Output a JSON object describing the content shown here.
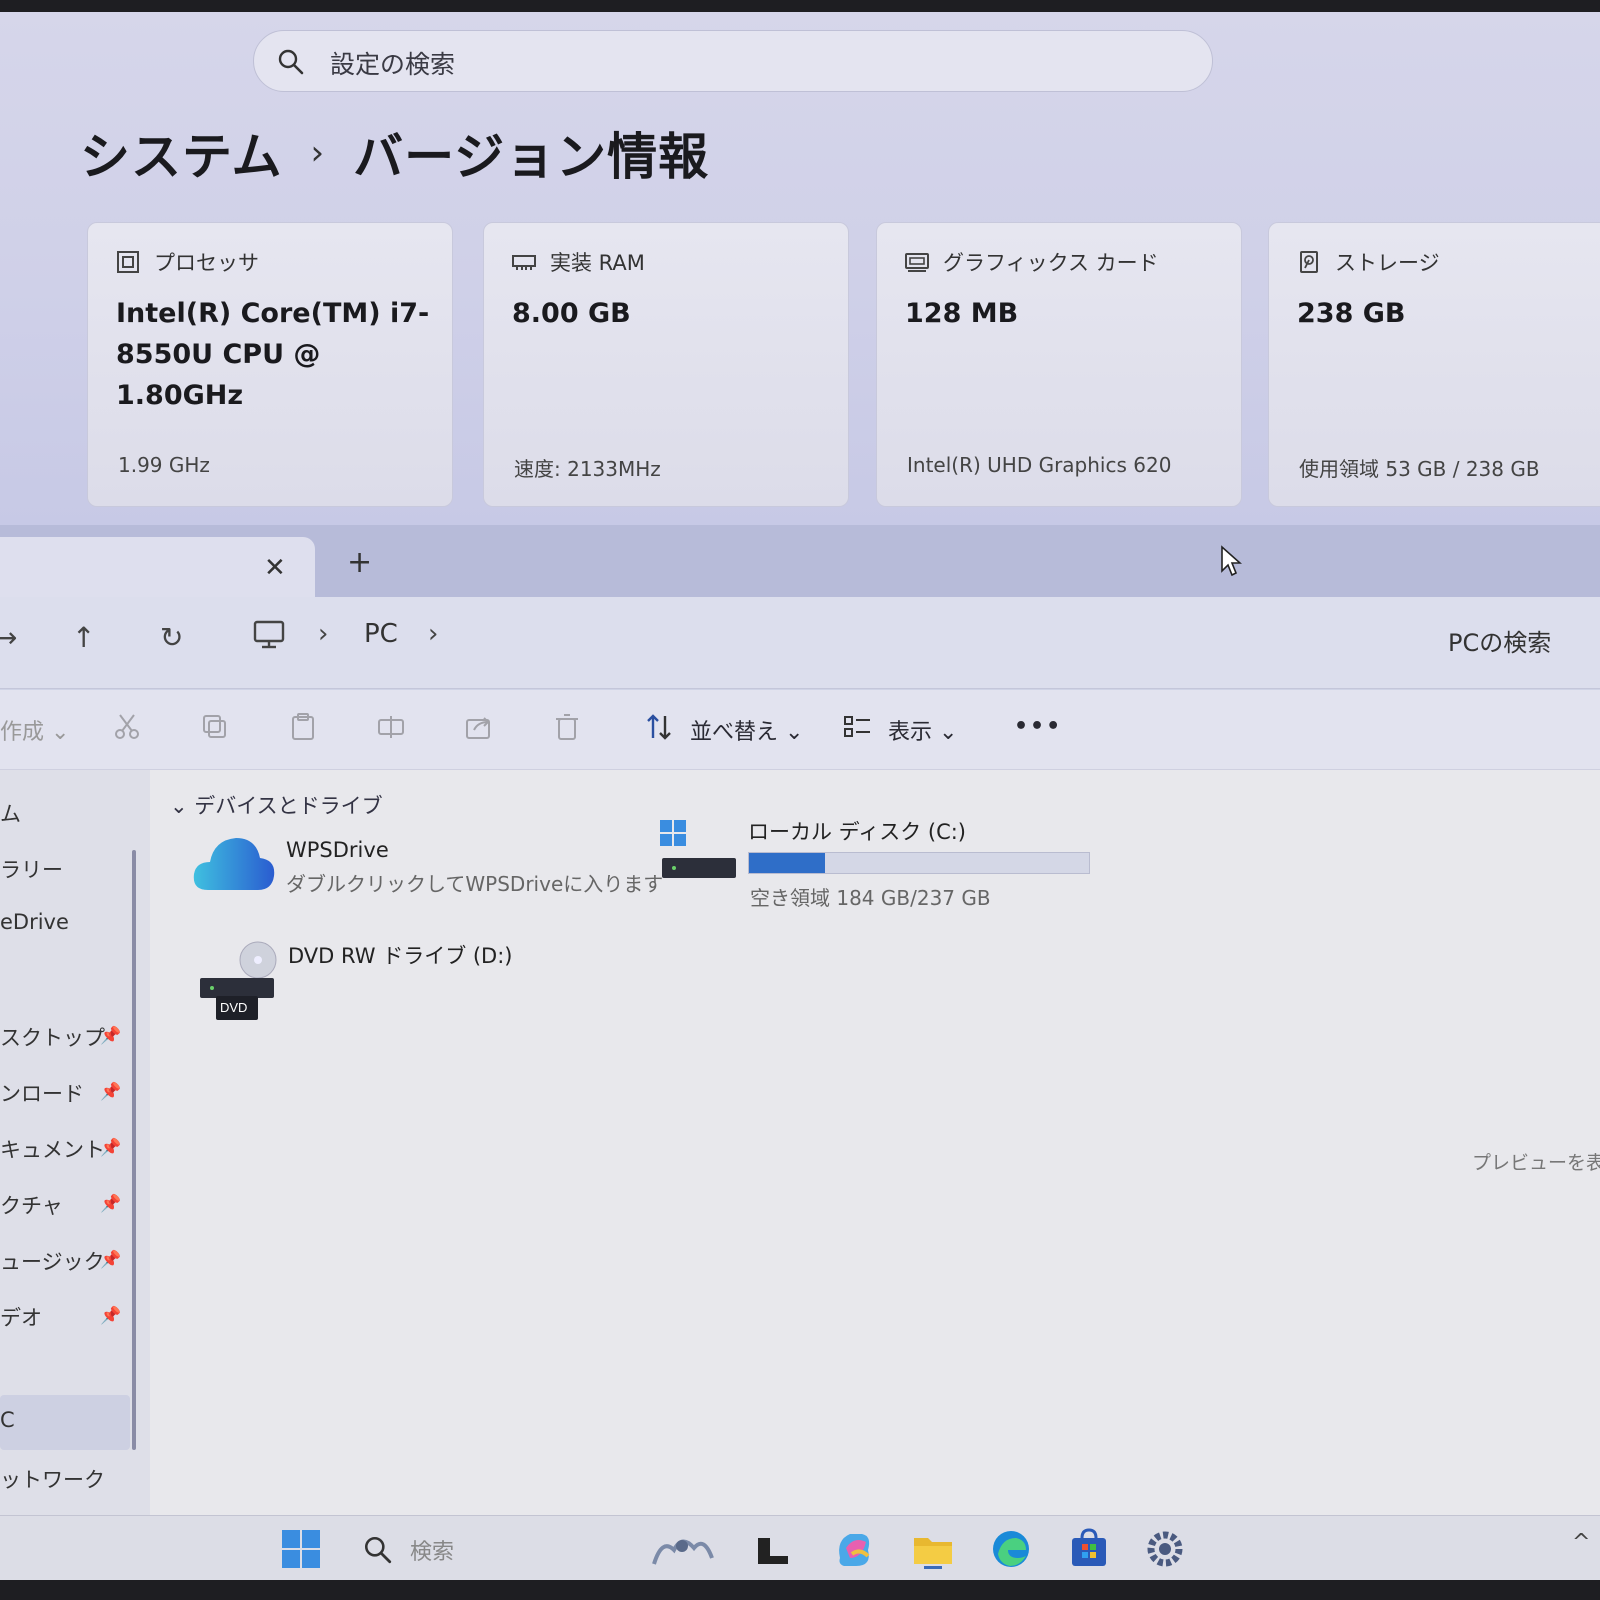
{
  "settings": {
    "search_placeholder": "設定の検索",
    "breadcrumb": {
      "parent": "システム",
      "separator": "›",
      "current": "バージョン情報"
    },
    "cards": [
      {
        "icon": "processor-icon",
        "title": "プロセッサ",
        "value": "Intel(R) Core(TM) i7-8550U CPU @ 1.80GHz",
        "sub": "1.99 GHz"
      },
      {
        "icon": "ram-icon",
        "title": "実装 RAM",
        "value": "8.00 GB",
        "sub": "速度: 2133MHz"
      },
      {
        "icon": "graphics-card-icon",
        "title": "グラフィックス カード",
        "value": "128 MB",
        "sub": "Intel(R) UHD Graphics 620"
      },
      {
        "icon": "storage-icon",
        "title": "ストレージ",
        "value": "238 GB",
        "sub": "使用領域 53 GB / 238 GB"
      }
    ]
  },
  "explorer": {
    "tab": {
      "close": "✕",
      "add": "+"
    },
    "nav": {
      "back": "→",
      "up": "↑",
      "refresh": "↻",
      "address_sep": "›",
      "address_pc": "PC",
      "search_placeholder": "PCの検索"
    },
    "cmdbar": {
      "new_label": "作成",
      "sort_label": "並べ替え",
      "view_label": "表示",
      "more_label": "•••",
      "chevron": "⌄"
    },
    "nav_pane": [
      {
        "label": "ム"
      },
      {
        "label": "ラリー"
      },
      {
        "label": "eDrive"
      },
      {
        "label": "スクトップ",
        "pinned": true
      },
      {
        "label": "ンロード",
        "pinned": true
      },
      {
        "label": "キュメント",
        "pinned": true
      },
      {
        "label": "クチャ",
        "pinned": true
      },
      {
        "label": "ュージック",
        "pinned": true
      },
      {
        "label": "デオ",
        "pinned": true
      },
      {
        "label": "C"
      },
      {
        "label": "ットワーク"
      }
    ],
    "group_header": "デバイスとドライブ",
    "group_chevron": "⌄",
    "drives": {
      "wps": {
        "name": "WPSDrive",
        "desc": "ダブルクリックしてWPSDriveに入ります"
      },
      "dvd": {
        "name": "DVD RW ドライブ (D:)",
        "badge": "DVD"
      },
      "c": {
        "name": "ローカル ディスク (C:)",
        "desc": "空き領域 184 GB/237 GB",
        "used_fraction": 0.224
      }
    },
    "preview_msg": "プレビューを表示"
  },
  "taskbar": {
    "search_label": "検索",
    "tray_arrow": "^",
    "apps": [
      "windows-start-icon",
      "search-icon",
      "widgets-icon",
      "task-view-icon",
      "copilot-icon",
      "file-explorer-icon",
      "edge-icon",
      "store-icon",
      "settings-icon"
    ]
  },
  "colors": {
    "accent": "#2f6ec8",
    "card_bg": "#e2e2ee",
    "tab_bar": "#b7bbd9"
  }
}
